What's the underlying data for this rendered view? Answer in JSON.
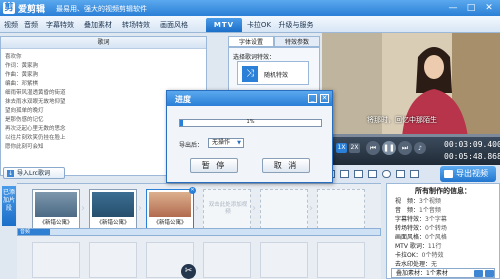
{
  "app": {
    "title": "爱剪辑",
    "slogan": "最易用、强大的视频剪辑软件",
    "window_buttons": [
      "—",
      "□",
      "✕"
    ]
  },
  "tabs": [
    {
      "label": "视频",
      "active": false
    },
    {
      "label": "音频",
      "active": false
    },
    {
      "label": "字幕特效",
      "active": false
    },
    {
      "label": "叠加素材",
      "active": false
    },
    {
      "label": "转场特效",
      "active": false
    },
    {
      "label": "画面风格",
      "active": false
    },
    {
      "label": "MTV",
      "active": true
    },
    {
      "label": "卡拉OK",
      "active": false
    },
    {
      "label": "升级与服务",
      "active": false
    }
  ],
  "lyrics": {
    "header": "歌词",
    "lines": [
      "喜欢你",
      "作词：黄家驹",
      "作曲：黄家驹",
      "编曲：邓紫棋",
      "细雨带风湿透黄昏的街道",
      "抹去雨水双眼无故地仰望",
      "望向孤单的晚灯",
      "是那伤感的记忆",
      "再次泛起心里无数的思念",
      "以往片刻欢笑仍挂在脸上",
      "愿你此刻可会知"
    ],
    "import_button": "导入Lrc歌词"
  },
  "settings": {
    "tabs": [
      "字体设置",
      "特效参数"
    ],
    "effect_label": "选择歌词特效：",
    "effect_name": "随机特效"
  },
  "player": {
    "subtitle": "将那时，回忆中那陌生",
    "speeds": [
      "1X",
      "2X"
    ],
    "time_current": "00:03:09.400",
    "time_total": "00:05:48.868"
  },
  "export": {
    "button": "导出视频"
  },
  "timeline": {
    "added_label": "已添加片段",
    "clips": [
      {
        "name": "《新错公寓》",
        "thumb_color": "#5f7f9a"
      },
      {
        "name": "《新错公寓》",
        "thumb_color": "#3f6a8c"
      },
      {
        "name": "《新错公寓》",
        "thumb_color": "#c9886a"
      }
    ],
    "empty_slot_text": "双击此处添加视频",
    "audio_label": "音频"
  },
  "info": {
    "title": "所有制作的信息：",
    "rows": [
      {
        "label": "视　频：",
        "value": "3个视频"
      },
      {
        "label": "音　频：",
        "value": "1个音频"
      },
      {
        "label": "字幕特效：",
        "value": "3个字幕"
      },
      {
        "label": "转场特效：",
        "value": "0个转场"
      },
      {
        "label": "画面风格：",
        "value": "0个风格"
      },
      {
        "label": "MTV 歌词：",
        "value": "11行"
      },
      {
        "label": "卡拉OK：",
        "value": "0个特效"
      },
      {
        "label": "去水印处理：",
        "value": "无"
      }
    ],
    "stack_label": "叠加素材：",
    "stack_value": "1个素材"
  },
  "dialog": {
    "title": "进度",
    "progress_percent": 1,
    "progress_text": "1%",
    "export_to_label": "导出后：",
    "export_to_value": "无操作",
    "pause_button": "暂 停",
    "cancel_button": "取 消"
  },
  "colors": {
    "accent": "#2a7fd6",
    "active_tab": "#1c6fc8"
  }
}
